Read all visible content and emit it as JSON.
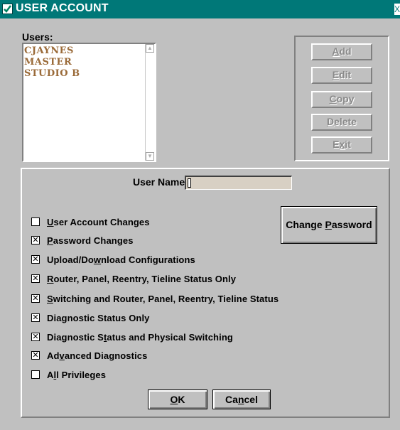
{
  "window": {
    "title": "USER ACCOUNT",
    "close_glyph": "X"
  },
  "users": {
    "label": "Users:",
    "items": [
      "CJAYNES",
      "MASTER",
      "STUDIO B"
    ]
  },
  "side_buttons": [
    {
      "label": "Add",
      "mnemonic": "A",
      "rest": "dd"
    },
    {
      "label": "Edit",
      "mnemonic": "E",
      "rest": "dit"
    },
    {
      "label": "Copy",
      "mnemonic": "C",
      "rest": "opy"
    },
    {
      "label": "Delete",
      "mnemonic": "D",
      "rest": "elete"
    },
    {
      "label": "Exit",
      "pre": "E",
      "mnemonic": "x",
      "rest": "it"
    }
  ],
  "username": {
    "label": "User Name:",
    "value": ""
  },
  "change_password": {
    "pre": "Change ",
    "mnemonic": "P",
    "rest": "assword"
  },
  "privileges": [
    {
      "pre": "",
      "mnemonic": "U",
      "rest": "ser Account Changes",
      "checked": false
    },
    {
      "pre": "",
      "mnemonic": "P",
      "rest": "assword Changes",
      "checked": true
    },
    {
      "pre": "Upload/Do",
      "mnemonic": "w",
      "rest": "nload Configurations",
      "checked": true
    },
    {
      "pre": "",
      "mnemonic": "R",
      "rest": "outer, Panel, Reentry, Tieline Status Only",
      "checked": true
    },
    {
      "pre": "",
      "mnemonic": "S",
      "rest": "witching and Router, Panel, Reentry,  Tieline Status",
      "checked": true
    },
    {
      "pre": "Dia",
      "mnemonic": "g",
      "rest": "nostic Status Only",
      "checked": true
    },
    {
      "pre": "Diagnostic S",
      "mnemonic": "t",
      "rest": "atus and Physical Switching",
      "checked": true
    },
    {
      "pre": "Ad",
      "mnemonic": "v",
      "rest": "anced Diagnostics",
      "checked": true
    },
    {
      "pre": "A",
      "mnemonic": "l",
      "rest": "l Privileges",
      "checked": false
    }
  ],
  "footer": {
    "ok": {
      "mnemonic": "O",
      "rest": "K"
    },
    "cancel": {
      "pre": "Ca",
      "mnemonic": "n",
      "rest": "cel"
    }
  },
  "check_glyph": "☒"
}
